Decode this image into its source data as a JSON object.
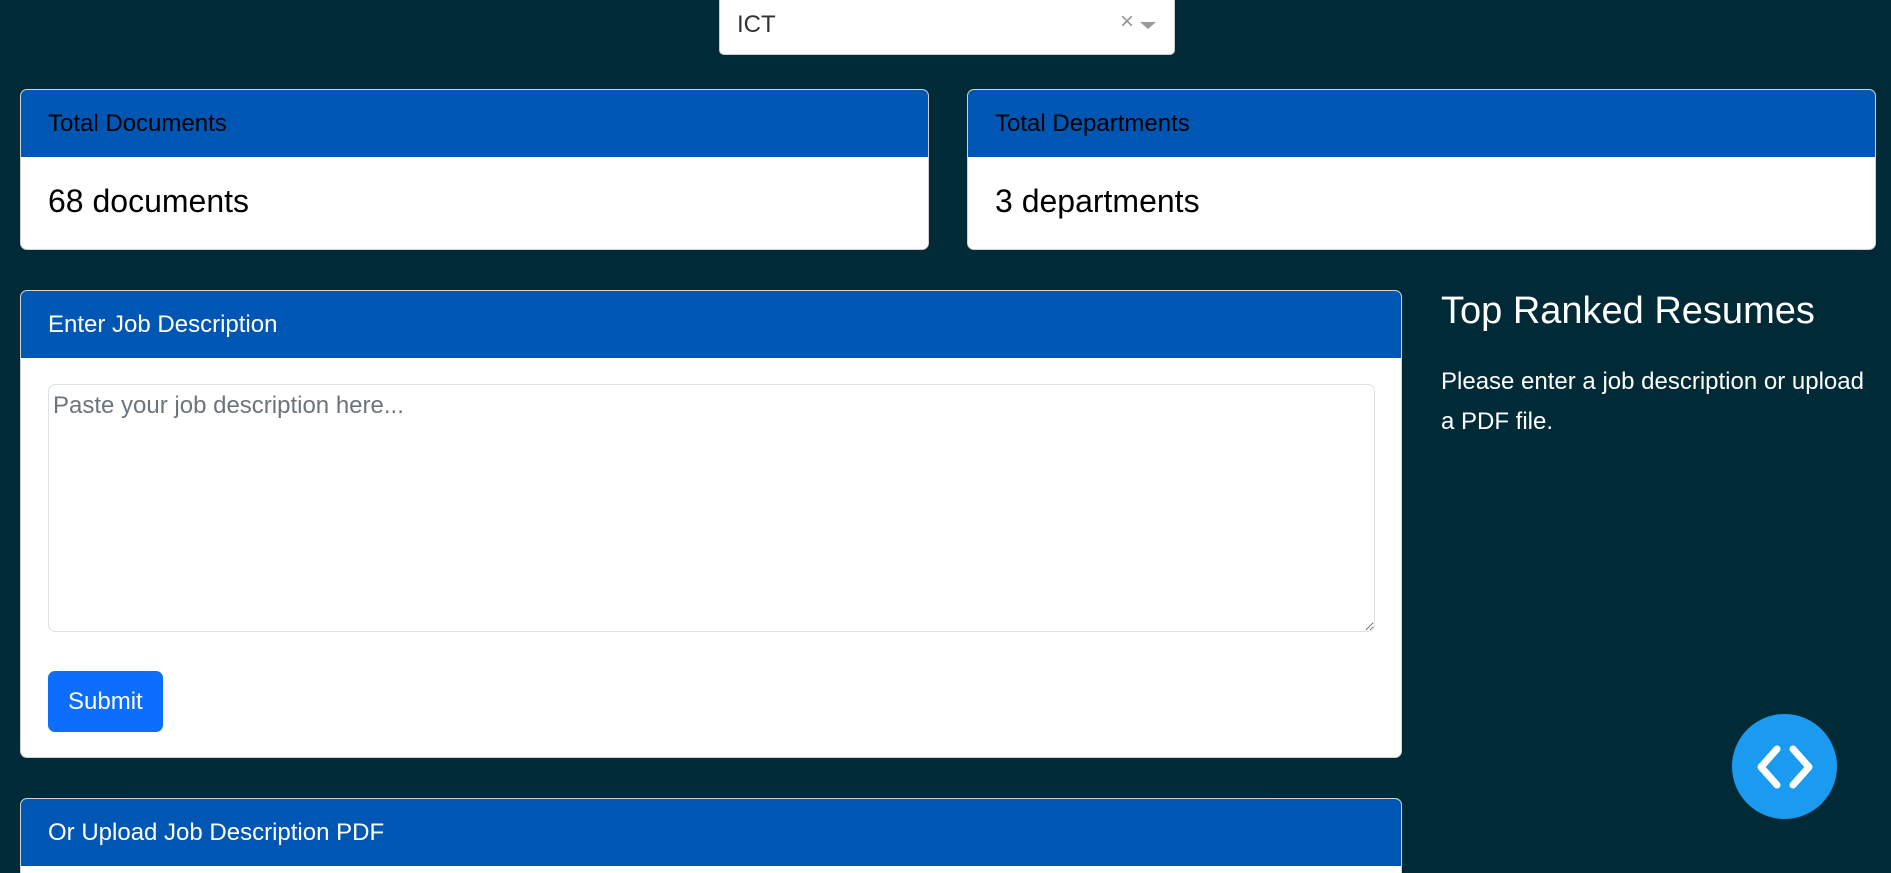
{
  "department_select": {
    "value": "ICT",
    "clear_glyph": "×",
    "arrow_icon": "caret-down-icon"
  },
  "stats": {
    "documents": {
      "label": "Total Documents",
      "value": "68 documents"
    },
    "departments": {
      "label": "Total Departments",
      "value": "3 departments"
    }
  },
  "job_description": {
    "header": "Enter Job Description",
    "placeholder": "Paste your job description here...",
    "submit_label": "Submit"
  },
  "upload": {
    "header": "Or Upload Job Description PDF"
  },
  "results": {
    "title": "Top Ranked Resumes",
    "message": "Please enter a job description or upload a PDF file."
  },
  "fab": {
    "icon": "code-brackets-icon"
  },
  "colors": {
    "background": "#002b36",
    "card_header": "#0056b3",
    "primary_button": "#0d6efd",
    "fab": "#1a9bf0"
  }
}
